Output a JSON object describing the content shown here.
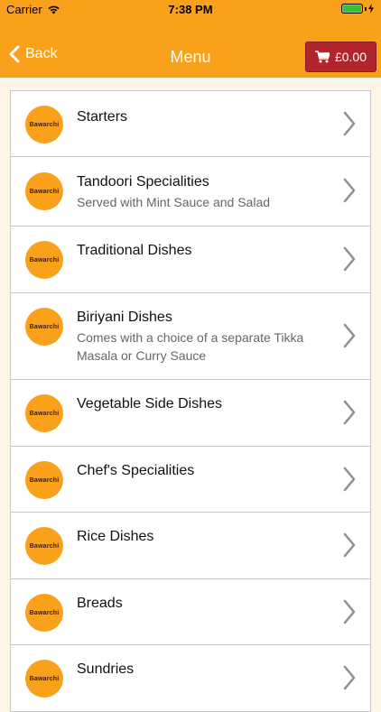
{
  "status_bar": {
    "carrier": "Carrier",
    "time": "7:38 PM"
  },
  "nav": {
    "back_label": "Back",
    "title": "Menu",
    "cart_total": "£0.00"
  },
  "logo_text": "Bawarchi",
  "menu": {
    "items": [
      {
        "title": "Starters",
        "subtitle": ""
      },
      {
        "title": "Tandoori Specialities",
        "subtitle": "Served with Mint Sauce and Salad"
      },
      {
        "title": "Traditional Dishes",
        "subtitle": ""
      },
      {
        "title": "Biriyani Dishes",
        "subtitle": "Comes with a choice of a separate Tikka Masala or Curry Sauce"
      },
      {
        "title": "Vegetable Side Dishes",
        "subtitle": ""
      },
      {
        "title": "Chef's Specialities",
        "subtitle": ""
      },
      {
        "title": "Rice Dishes",
        "subtitle": ""
      },
      {
        "title": "Breads",
        "subtitle": ""
      },
      {
        "title": "Sundries",
        "subtitle": ""
      }
    ]
  },
  "colors": {
    "brand_orange": "#f9a11b",
    "cart_red": "#b2262b",
    "background": "#fdf5e6"
  },
  "icons": [
    "wifi-icon",
    "battery-icon",
    "chevron-left-icon",
    "cart-icon",
    "chevron-right-icon",
    "restaurant-logo"
  ]
}
